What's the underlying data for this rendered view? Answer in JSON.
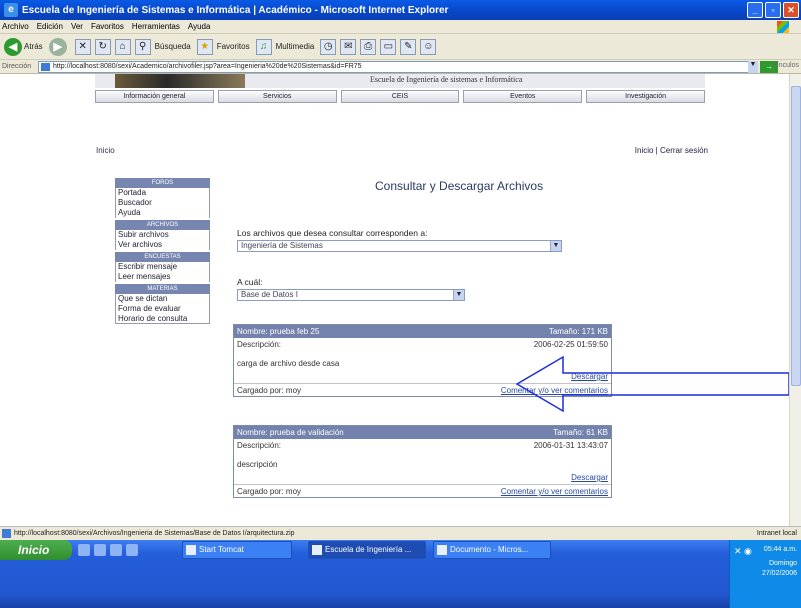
{
  "window": {
    "title": "Escuela de Ingeniería de Sistemas e Informática | Académico - Microsoft Internet Explorer"
  },
  "menu": [
    "Archivo",
    "Edición",
    "Ver",
    "Favoritos",
    "Herramientas",
    "Ayuda"
  ],
  "toolbar": {
    "back": "Atrás",
    "search": "Búsqueda",
    "favorites": "Favoritos",
    "multimedia": "Multimedia"
  },
  "address": {
    "label": "Dirección",
    "url": "http://localhost:8080/sexi/Academico/archivofiler.jsp?area=Ingenieria%20de%20Sistemas&id=FR75",
    "links": "Vínculos"
  },
  "banner": {
    "school": "Escuela de Ingeniería de sistemas e Informática"
  },
  "nav": [
    "Información general",
    "Servicios",
    "CEIS",
    "Eventos",
    "Investigación"
  ],
  "page": {
    "home": "Inicio",
    "top_links": "Inicio | Cerrar sesión",
    "heading": "Consultar y Descargar Archivos",
    "q_label": "Los archivos que desea consultar corresponden a:",
    "q_value": "Ingeniería de Sistemas",
    "which_label": "A cuál:",
    "which_value": "Base de Datos I"
  },
  "sidebar": [
    {
      "head": "FOROS",
      "items": [
        "Portada",
        "Buscador",
        "Ayuda"
      ]
    },
    {
      "head": "ARCHIVOS",
      "items": [
        "Subir archivos",
        "Ver archivos"
      ]
    },
    {
      "head": "ENCUESTAS",
      "items": [
        "Escribir mensaje",
        "Leer mensajes"
      ]
    },
    {
      "head": "MATERIAS",
      "items": [
        "Que se dictan",
        "Forma de evaluar",
        "Horario de consulta"
      ]
    }
  ],
  "files": [
    {
      "name": "Nombre: prueba feb 25",
      "size": "Tamaño: 171 KB",
      "desc_label": "Descripción:",
      "date": "2006-02-25 01:59:50",
      "desc": "carga de archivo desde casa",
      "download": "Descargar",
      "uploader": "Cargado por: moy",
      "comments": "Comentar y/o ver comentarios"
    },
    {
      "name": "Nombre: prueba de validación",
      "size": "Tamaño: 61 KB",
      "desc_label": "Descripción:",
      "date": "2006-01-31 13:43:07",
      "desc": "descripción",
      "download": "Descargar",
      "uploader": "Cargado por: moy",
      "comments": "Comentar y/o ver comentarios"
    }
  ],
  "status": {
    "url": "http://localhost:8080/sexi/Archivos/Ingenieria de Sistemas/Base de Datos I/arquitectura.zip",
    "zone": "Intranet local"
  },
  "taskbar": {
    "start": "Inicio",
    "tasks": [
      "Start Tomcat",
      "Escuela de Ingeniería ...",
      "Documento - Micros..."
    ],
    "time": "05:44 a.m.",
    "day": "Domingo",
    "date": "27/02/2006"
  },
  "colors": {
    "accent": "#7382ac",
    "link": "#2848a0",
    "annotation_arrow": "#1b2fd6"
  }
}
